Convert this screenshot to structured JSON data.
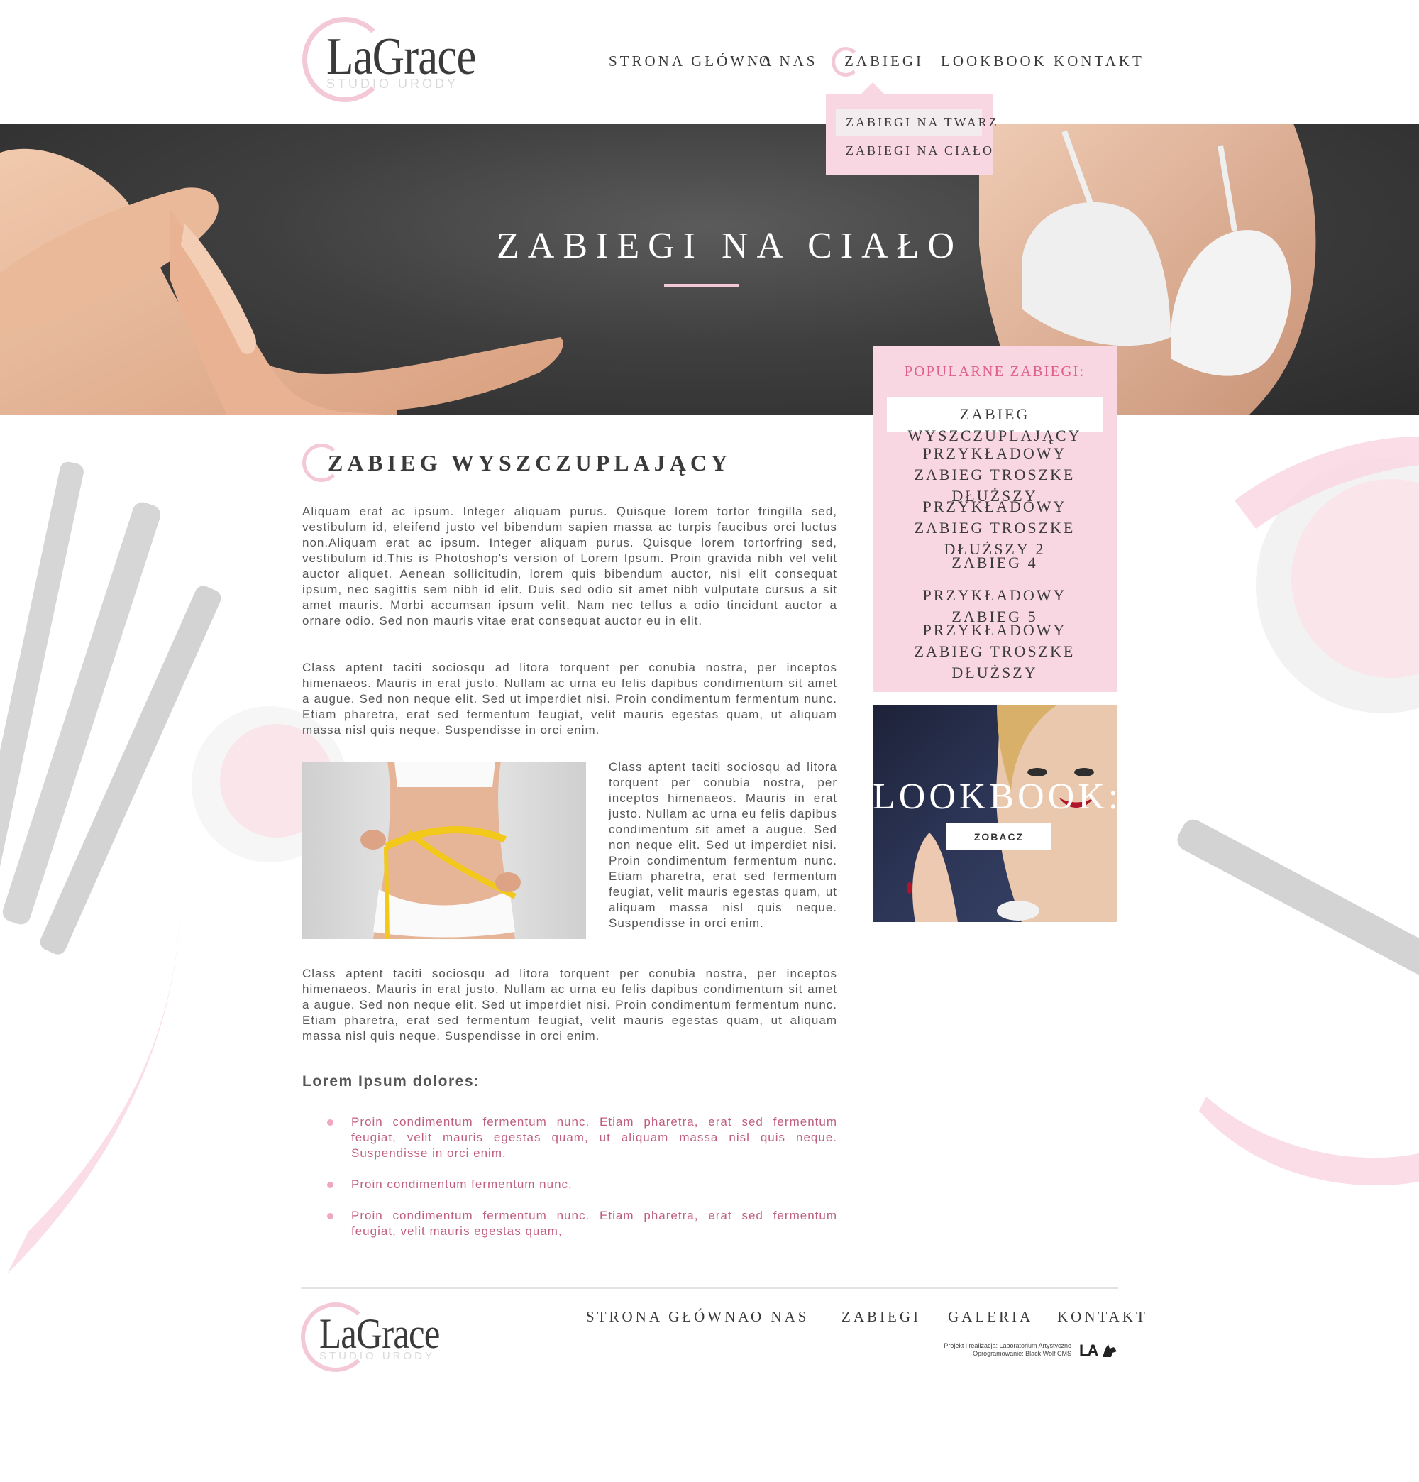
{
  "brand": {
    "name": "LaGrace",
    "tagline": "STUDIO URODY",
    "accent_pink": "#f4c9d7",
    "panel_pink": "#f9d7e2",
    "link_pink": "#c05e80",
    "text_dark": "#3a3a3a"
  },
  "header": {
    "nav": [
      {
        "label": "STRONA GŁÓWNA"
      },
      {
        "label": "O NAS"
      },
      {
        "label": "ZABIEGI",
        "active": true
      },
      {
        "label": "LOOKBOOK"
      },
      {
        "label": "KONTAKT"
      }
    ],
    "dropdown": [
      {
        "label": "ZABIEGI NA TWARZ",
        "active": true
      },
      {
        "label": "ZABIEGI NA CIAŁO"
      }
    ]
  },
  "hero": {
    "title": "ZABIEGI NA CIAŁO"
  },
  "main": {
    "title": "ZABIEG WYSZCZUPLAJĄCY",
    "paragraphs": [
      "Aliquam erat ac ipsum. Integer aliquam purus. Quisque lorem tortor fringilla sed, vestibulum id, eleifend justo vel bibendum sapien massa ac turpis faucibus orci luctus non.Aliquam erat ac ipsum. Integer aliquam purus. Quisque lorem tortorfring sed, vestibulum id.This is Photoshop's version of Lorem Ipsum. Proin gravida nibh vel velit auctor aliquet. Aenean sollicitudin, lorem quis bibendum auctor, nisi elit consequat ipsum, nec sagittis sem nibh id elit. Duis sed odio sit amet nibh vulputate cursus a sit amet mauris. Morbi accumsan ipsum velit. Nam nec tellus a odio tincidunt auctor a ornare odio. Sed non mauris vitae erat consequat auctor eu in elit.",
      "Class aptent taciti sociosqu ad litora torquent per conubia nostra, per inceptos himenaeos. Mauris in erat justo. Nullam ac urna eu felis dapibus condimentum sit amet a augue. Sed non neque elit. Sed ut imperdiet nisi. Proin condimentum fermentum nunc. Etiam pharetra, erat sed fermentum feugiat, velit mauris egestas quam, ut aliquam massa nisl quis neque. Suspendisse in orci enim.",
      "Class aptent taciti sociosqu ad litora torquent per conubia nostra, per inceptos himenaeos. Mauris in erat justo. Nullam ac urna eu felis dapibus condimentum sit amet a augue. Sed non neque elit. Sed ut imperdiet nisi. Proin condimentum fermentum nunc. Etiam pharetra, erat sed fermentum feugiat, velit mauris egestas quam, ut aliquam massa nisl quis neque. Suspendisse in orci enim.",
      "Class aptent taciti sociosqu ad litora torquent per conubia nostra, per inceptos himenaeos. Mauris in erat justo. Nullam ac urna eu felis dapibus condimentum sit amet a augue. Sed non neque elit. Sed ut imperdiet nisi. Proin condimentum fermentum nunc. Etiam pharetra, erat sed fermentum feugiat, velit mauris egestas quam, ut aliquam massa nisl quis neque. Suspendisse in orci enim."
    ],
    "subheading": "Lorem Ipsum dolores:",
    "bullets": [
      "Proin condimentum fermentum nunc. Etiam pharetra, erat sed fermentum feugiat, velit mauris egestas quam, ut aliquam massa nisl quis neque. Suspendisse in orci enim.",
      "Proin condimentum fermentum nunc.",
      "Proin condimentum fermentum nunc. Etiam pharetra, erat sed fermentum feugiat, velit mauris egestas quam,"
    ]
  },
  "sidebar": {
    "heading": "POPULARNE ZABIEGI:",
    "items": [
      {
        "label": "ZABIEG WYSZCZUPLAJĄCY",
        "active": true
      },
      {
        "label": "PRZYKŁADOWY ZABIEG TROSZKE DŁUŻSZY"
      },
      {
        "label": "PRZYKŁADOWY ZABIEG TROSZKE DŁUŻSZY 2"
      },
      {
        "label": "ZABIEG 4"
      },
      {
        "label": "PRZYKŁADOWY ZABIEG 5"
      },
      {
        "label": "PRZYKŁADOWY ZABIEG TROSZKE DŁUŻSZY"
      }
    ]
  },
  "lookbook": {
    "title": "LOOKBOOK:",
    "button": "ZOBACZ"
  },
  "footer": {
    "nav": [
      {
        "label": "STRONA GŁÓWNA"
      },
      {
        "label": "O NAS"
      },
      {
        "label": "ZABIEGI"
      },
      {
        "label": "GALERIA"
      },
      {
        "label": "KONTAKT"
      }
    ],
    "credits_line1": "Projekt i realizacja: Laboratorium Artystyczne",
    "credits_line2": "Oprogramowanie: Black Wolf CMS",
    "credit_logo_text": "LA"
  }
}
